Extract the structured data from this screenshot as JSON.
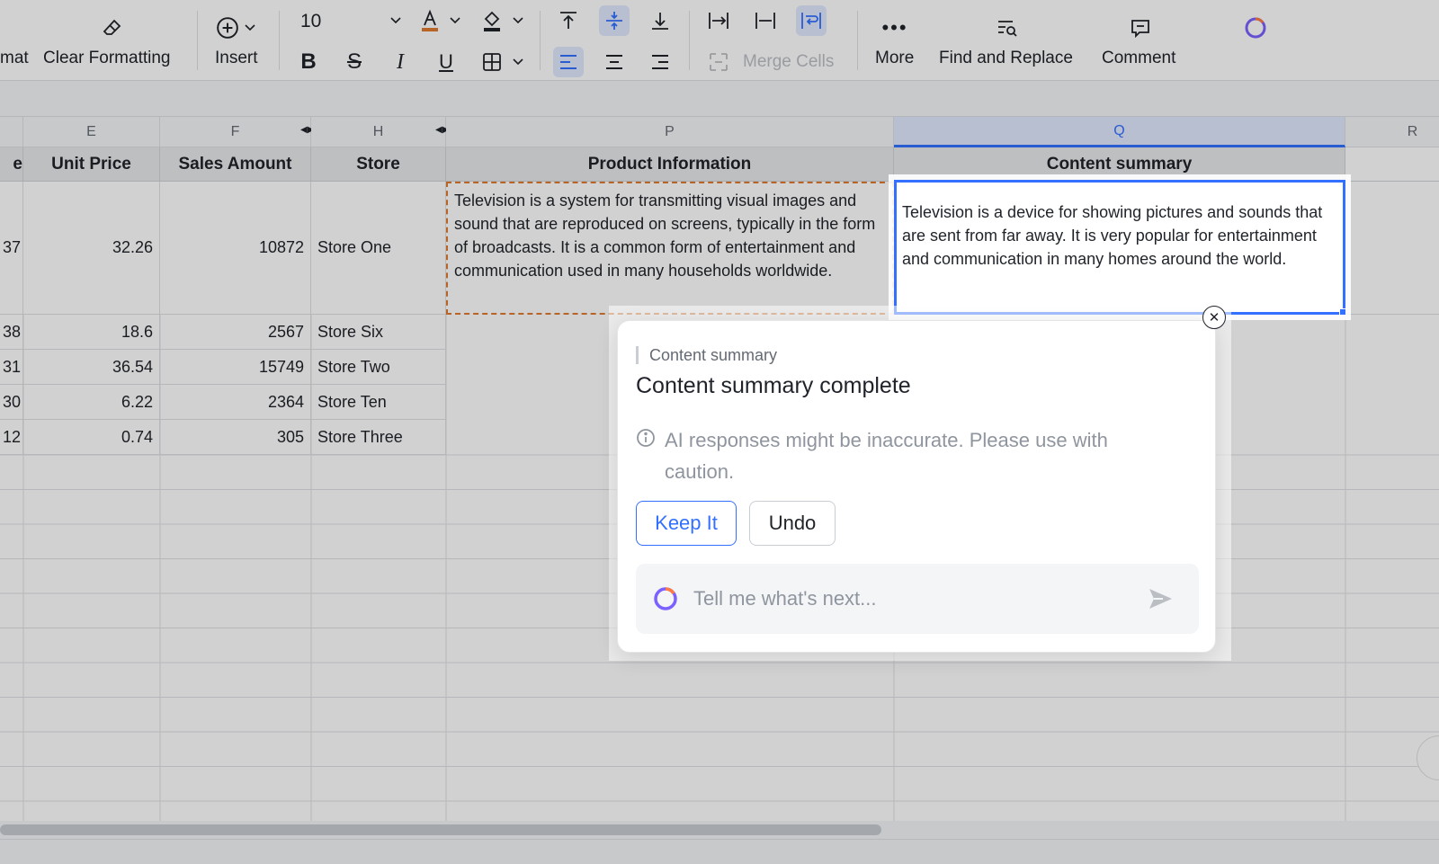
{
  "toolbar": {
    "format_partial": "mat",
    "clear_formatting": "Clear Formatting",
    "insert": "Insert",
    "font_size": "10",
    "merge_cells": "Merge Cells",
    "more": "More",
    "find_replace": "Find and Replace",
    "comment": "Comment"
  },
  "columns": {
    "e": "E",
    "f": "F",
    "h": "H",
    "p": "P",
    "q": "Q",
    "r": "R"
  },
  "headers": {
    "partial": "e",
    "unit_price": "Unit Price",
    "sales_amount": "Sales Amount",
    "store": "Store",
    "product_information": "Product Information",
    "content_summary": "Content summary"
  },
  "rows": [
    {
      "qty": "37",
      "unit_price": "32.26",
      "sales_amount": "10872",
      "store": "Store One"
    },
    {
      "qty": "38",
      "unit_price": "18.6",
      "sales_amount": "2567",
      "store": "Store Six"
    },
    {
      "qty": "31",
      "unit_price": "36.54",
      "sales_amount": "15749",
      "store": "Store Two"
    },
    {
      "qty": "30",
      "unit_price": "6.22",
      "sales_amount": "2364",
      "store": "Store Ten"
    },
    {
      "qty": "12",
      "unit_price": "0.74",
      "sales_amount": "305",
      "store": "Store Three"
    }
  ],
  "product_info_text": "Television is a system for transmitting visual images and sound that are reproduced on screens, typically in the form of broadcasts. It is a common form of entertainment and communication used in many households worldwide.",
  "summary_text": "Television is a device for showing pictures and sounds that are sent from far away. It is very popular for entertainment and communication in many homes around the world.",
  "popup": {
    "tag": "Content summary",
    "title": "Content summary complete",
    "warning": "AI responses might be inaccurate. Please use with caution.",
    "keep_label": "Keep It",
    "undo_label": "Undo",
    "input_placeholder": "Tell me what's next...",
    "close_glyph": "✕"
  },
  "colors": {
    "accent": "#3370ff",
    "copy_border": "#e07a2f"
  }
}
